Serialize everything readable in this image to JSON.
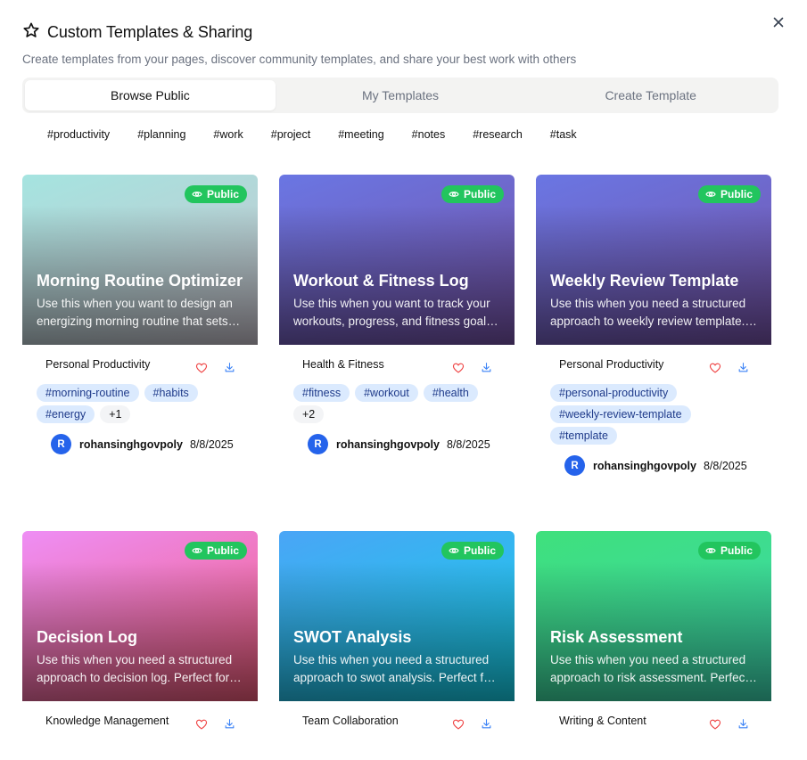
{
  "header": {
    "title": "Custom Templates & Sharing",
    "subtitle": "Create templates from your pages, discover community templates, and share your best work with others"
  },
  "tabs": [
    {
      "label": "Browse Public",
      "active": true
    },
    {
      "label": "My Templates",
      "active": false
    },
    {
      "label": "Create Template",
      "active": false
    }
  ],
  "tag_filters": [
    "#productivity",
    "#planning",
    "#work",
    "#project",
    "#meeting",
    "#notes",
    "#research",
    "#task"
  ],
  "badge_label": "Public",
  "cards": [
    {
      "title": "Morning Routine Optimizer",
      "description": "Use this when you want to design an energizing morning routine that sets you up for success",
      "category": "Personal Productivity",
      "tags": [
        "#morning-routine",
        "#habits",
        "#energy"
      ],
      "more": "+1",
      "author_initial": "R",
      "author": "rohansinghgovpoly",
      "date": "8/8/2025",
      "gradient": [
        "#a5e4e0",
        "#c9c2cc"
      ]
    },
    {
      "title": "Workout & Fitness Log",
      "description": "Use this when you want to track your workouts, progress, and fitness goals over time",
      "category": "Health & Fitness",
      "tags": [
        "#fitness",
        "#workout",
        "#health"
      ],
      "more": "+2",
      "author_initial": "R",
      "author": "rohansinghgovpoly",
      "date": "8/8/2025",
      "gradient": [
        "#6a76e3",
        "#7652a6"
      ]
    },
    {
      "title": "Weekly Review Template",
      "description": "Use this when you need a structured approach to weekly review template. Perfect for reflection",
      "category": "Personal Productivity",
      "tags": [
        "#personal-productivity",
        "#weekly-review-template",
        "#template"
      ],
      "more": "",
      "author_initial": "R",
      "author": "rohansinghgovpoly",
      "date": "8/8/2025",
      "gradient": [
        "#6a76e3",
        "#7652a6"
      ]
    },
    {
      "title": "Decision Log",
      "description": "Use this when you need a structured approach to decision log. Perfect for teams",
      "category": "Knowledge Management",
      "tags": [],
      "more": "",
      "author_initial": "",
      "author": "",
      "date": "",
      "gradient": [
        "#ee8ef5",
        "#f05b78"
      ]
    },
    {
      "title": "SWOT Analysis",
      "description": "Use this when you need a structured approach to swot analysis. Perfect for planning",
      "category": "Team Collaboration",
      "tags": [],
      "more": "",
      "author_initial": "",
      "author": "",
      "date": "",
      "gradient": [
        "#4aa5f6",
        "#12d0e6"
      ]
    },
    {
      "title": "Risk Assessment",
      "description": "Use this when you need a structured approach to risk assessment. Perfect for projects",
      "category": "Writing & Content",
      "tags": [],
      "more": "",
      "author_initial": "",
      "author": "",
      "date": "",
      "gradient": [
        "#3fe07c",
        "#3bd6b0"
      ]
    }
  ]
}
